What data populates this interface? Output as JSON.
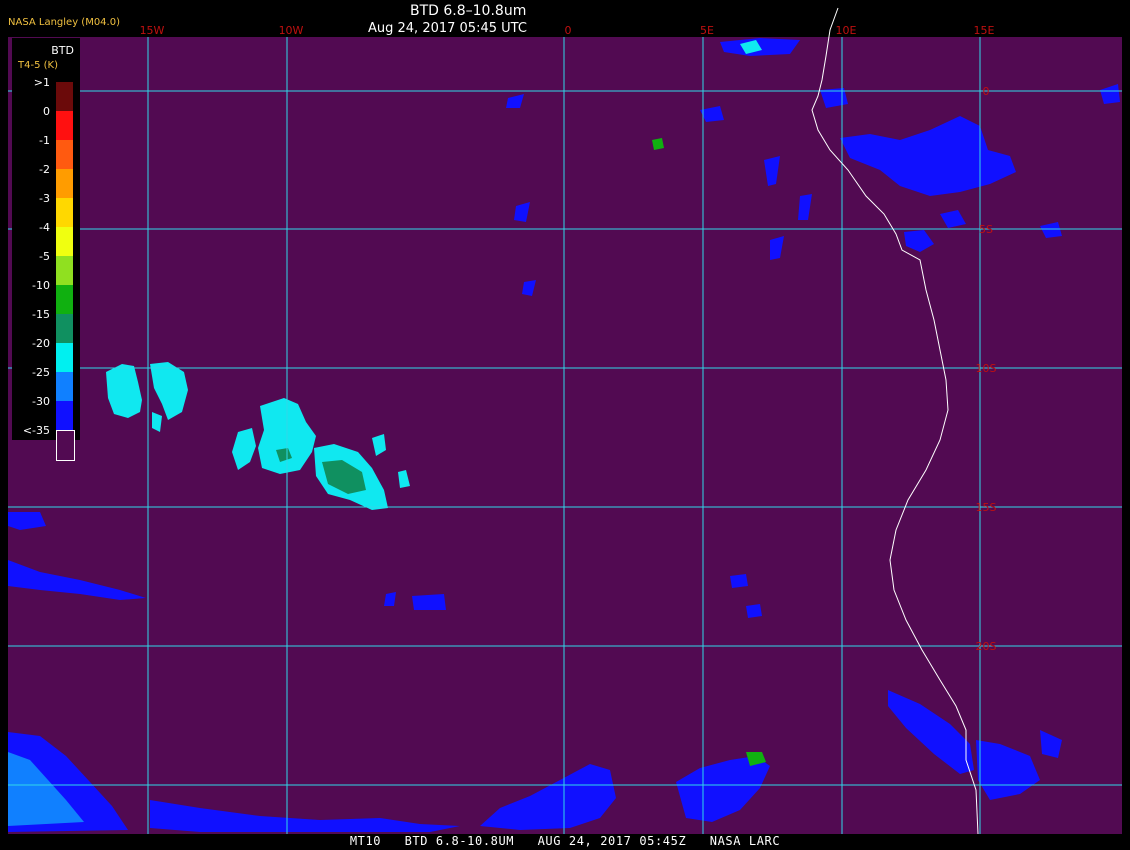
{
  "header": {
    "title": "BTD 6.8–10.8um",
    "datetime": "Aug 24, 2017 05:45 UTC",
    "org": "NASA Langley (M04.0)"
  },
  "footer": {
    "text": "MT10   BTD 6.8-10.8UM   AUG 24, 2017 05:45Z   NASA LARC"
  },
  "legend": {
    "title": "BTD",
    "unit": "T4-5 (K)",
    "levels": [
      {
        "label": ">1",
        "color": "#6b0a0a"
      },
      {
        "label": "0",
        "color": "#ff1010"
      },
      {
        "label": "-1",
        "color": "#ff5a10"
      },
      {
        "label": "-2",
        "color": "#ff9c00"
      },
      {
        "label": "-3",
        "color": "#ffd800"
      },
      {
        "label": "-4",
        "color": "#f0ff10"
      },
      {
        "label": "-5",
        "color": "#90e020"
      },
      {
        "label": "-10",
        "color": "#10b010"
      },
      {
        "label": "-15",
        "color": "#109060"
      },
      {
        "label": "-20",
        "color": "#00f0f0"
      },
      {
        "label": "-25",
        "color": "#1080ff"
      },
      {
        "label": "-30",
        "color": "#1010ff"
      },
      {
        "label": "<-35",
        "color": "#520a52"
      }
    ]
  },
  "grid": {
    "lon_labels": [
      "15W",
      "10W",
      "0",
      "5E",
      "10E",
      "15E"
    ],
    "lat_labels": [
      "0",
      "5S",
      "10S",
      "15S",
      "20S"
    ],
    "line_color": "#30d8e8",
    "label_color": "#c01010",
    "background_color": "#520a52",
    "coast_color": "#ffffff"
  }
}
